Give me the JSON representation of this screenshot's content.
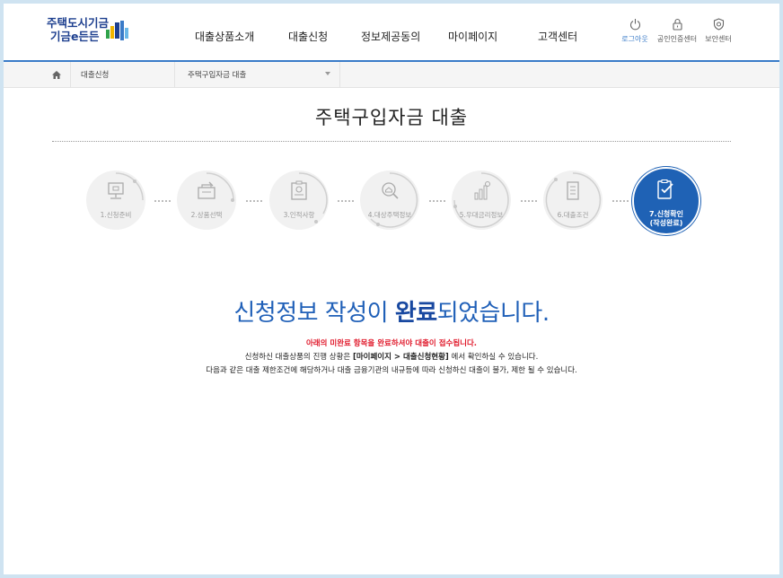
{
  "logo": {
    "line1": "주택도시기금",
    "line2": "기금e든든"
  },
  "nav": [
    "대출상품소개",
    "대출신청",
    "정보제공동의",
    "마이페이지",
    "고객센터"
  ],
  "util": [
    {
      "label": "로그아웃",
      "icon": "power-icon"
    },
    {
      "label": "공인인증센터",
      "icon": "lock-icon"
    },
    {
      "label": "보안센터",
      "icon": "shield-icon"
    }
  ],
  "breadcrumb": {
    "home_icon": "home-icon",
    "level1": "대출신청",
    "level2": "주택구입자금 대출"
  },
  "page_title": "주택구입자금 대출",
  "steps": [
    {
      "label": "1.신청준비",
      "icon": "monitor-icon"
    },
    {
      "label": "2.상품선택",
      "icon": "product-icon"
    },
    {
      "label": "3.인적사항",
      "icon": "id-card-icon"
    },
    {
      "label": "4.대상주택정보",
      "icon": "house-search-icon"
    },
    {
      "label": "5.우대금리정보",
      "icon": "chart-icon"
    },
    {
      "label": "6.대출조건",
      "icon": "document-icon"
    },
    {
      "label_line1": "7.신청확인",
      "label_line2": "(작성완료)",
      "icon": "check-document-icon"
    }
  ],
  "completion": {
    "before": "신청정보 작성이 ",
    "bold": "완료",
    "after": "되었습니다."
  },
  "notes": {
    "red": "아래의 미완료 항목을 완료하셔야 대출이 접수됩니다.",
    "line2_a": "신청하신 대출상품의 진행 상황은 ",
    "line2_bold": "[마이페이지 > 대출신청현황]",
    "line2_b": " 에서 확인하실 수 있습니다.",
    "line3": "다음과 같은 대출 제한조건에 해당하거나 대출 금융기관의 내규등에 따라 신청하신 대출이 불가, 제한 될 수 있습니다."
  },
  "colors": {
    "accent": "#1f62b5",
    "warning": "#e0182a",
    "frame": "#cfe3f1"
  }
}
